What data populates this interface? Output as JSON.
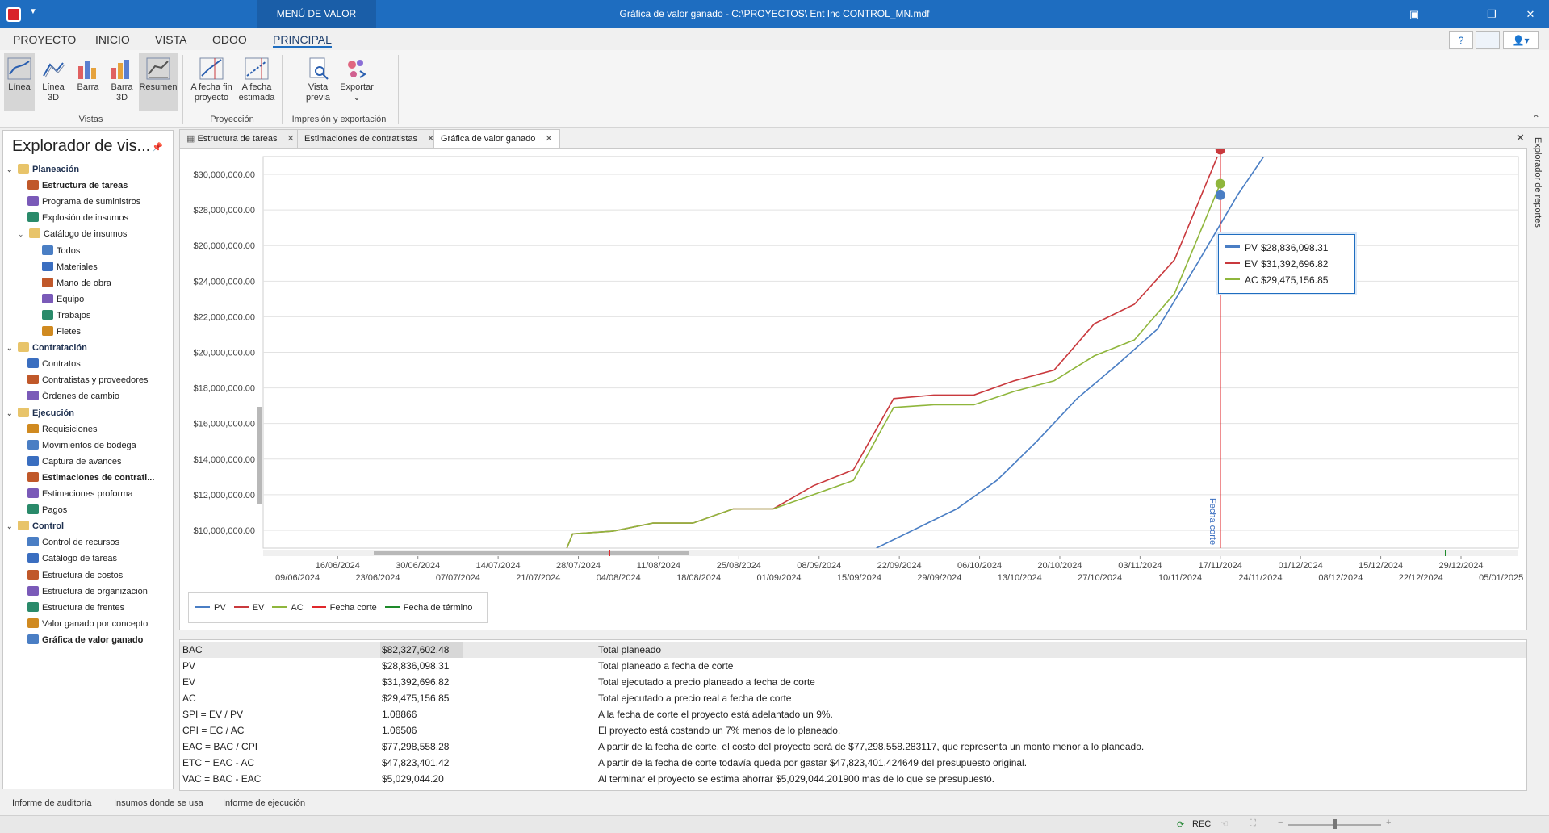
{
  "titlebar": {
    "menu_tab": "MENÚ DE VALOR GANADO",
    "title": "Gráfica de valor ganado - C:\\PROYECTOS\\ Ent Inc CONTROL_MN.mdf"
  },
  "ribbon_tabs": [
    "PROYECTO",
    "INICIO",
    "VISTA",
    "ODOO",
    "PRINCIPAL"
  ],
  "help_label": "?",
  "ribbon": {
    "views": [
      "Línea",
      "Línea 3D",
      "Barra",
      "Barra 3D",
      "Resumen"
    ],
    "projection": [
      "A fecha fin proyecto",
      "A fecha estimada"
    ],
    "print": [
      "Vista previa",
      "Exportar"
    ],
    "group_views": "Vistas",
    "group_projection": "Proyección",
    "group_print": "Impresión y exportación"
  },
  "explorer": {
    "title": "Explorador de vis...",
    "items": [
      {
        "label": "Planeación",
        "level": 0,
        "type": "head"
      },
      {
        "label": "Estructura de tareas",
        "level": 1,
        "bold": true
      },
      {
        "label": "Programa de suministros",
        "level": 1
      },
      {
        "label": "Explosión de insumos",
        "level": 1
      },
      {
        "label": "Catálogo de insumos",
        "level": 1,
        "type": "sub"
      },
      {
        "label": "Todos",
        "level": 2
      },
      {
        "label": "Materiales",
        "level": 2
      },
      {
        "label": "Mano de obra",
        "level": 2
      },
      {
        "label": "Equipo",
        "level": 2
      },
      {
        "label": "Trabajos",
        "level": 2
      },
      {
        "label": "Fletes",
        "level": 2
      },
      {
        "label": "Contratación",
        "level": 0,
        "type": "head"
      },
      {
        "label": "Contratos",
        "level": 1
      },
      {
        "label": "Contratistas y proveedores",
        "level": 1
      },
      {
        "label": "Órdenes de cambio",
        "level": 1
      },
      {
        "label": "Ejecución",
        "level": 0,
        "type": "head"
      },
      {
        "label": "Requisiciones",
        "level": 1
      },
      {
        "label": "Movimientos de bodega",
        "level": 1
      },
      {
        "label": "Captura de avances",
        "level": 1
      },
      {
        "label": "Estimaciones de contrati...",
        "level": 1,
        "bold": true
      },
      {
        "label": "Estimaciones proforma",
        "level": 1
      },
      {
        "label": "Pagos",
        "level": 1
      },
      {
        "label": "Control",
        "level": 0,
        "type": "head"
      },
      {
        "label": "Control de recursos",
        "level": 1
      },
      {
        "label": "Catálogo de tareas",
        "level": 1
      },
      {
        "label": "Estructura de costos",
        "level": 1
      },
      {
        "label": "Estructura de organización",
        "level": 1
      },
      {
        "label": "Estructura de frentes",
        "level": 1
      },
      {
        "label": "Valor ganado por concepto",
        "level": 1
      },
      {
        "label": "Gráfica de valor ganado",
        "level": 1,
        "bold": true
      }
    ]
  },
  "doc_tabs": [
    "Estructura de tareas",
    "Estimaciones de contratistas",
    "Gráfica de valor ganado"
  ],
  "chart_data": {
    "type": "line",
    "y_ticks": [
      "$10,000,000.00",
      "$12,000,000.00",
      "$14,000,000.00",
      "$16,000,000.00",
      "$18,000,000.00",
      "$20,000,000.00",
      "$22,000,000.00",
      "$24,000,000.00",
      "$26,000,000.00",
      "$28,000,000.00",
      "$30,000,000.00"
    ],
    "ylim": [
      9000000,
      31000000
    ],
    "x_ticks_top": [
      "16/06/2024",
      "30/06/2024",
      "14/07/2024",
      "28/07/2024",
      "11/08/2024",
      "25/08/2024",
      "08/09/2024",
      "22/09/2024",
      "06/10/2024",
      "20/10/2024",
      "03/11/2024",
      "17/11/2024",
      "01/12/2024",
      "15/12/2024",
      "29/12/2024"
    ],
    "x_ticks_bottom": [
      "09/06/2024",
      "23/06/2024",
      "07/07/2024",
      "21/07/2024",
      "04/08/2024",
      "18/08/2024",
      "01/09/2024",
      "15/09/2024",
      "29/09/2024",
      "13/10/2024",
      "27/10/2024",
      "10/11/2024",
      "24/11/2024",
      "08/12/2024",
      "22/12/2024",
      "05/01/2025"
    ],
    "series": [
      {
        "name": "PV",
        "color": "#4a7ec4",
        "points": [
          [
            "2024-09-18",
            9000000
          ],
          [
            "2024-10-02",
            11200000
          ],
          [
            "2024-10-09",
            12800000
          ],
          [
            "2024-10-16",
            15000000
          ],
          [
            "2024-10-23",
            17400000
          ],
          [
            "2024-10-30",
            19300000
          ],
          [
            "2024-11-06",
            21300000
          ],
          [
            "2024-11-13",
            25000000
          ],
          [
            "2024-11-20",
            28836098.31
          ],
          [
            "2024-11-25",
            31200000
          ]
        ]
      },
      {
        "name": "EV",
        "color": "#c9393d",
        "points": [
          [
            "2024-07-26",
            9000000
          ],
          [
            "2024-07-27",
            9800000
          ],
          [
            "2024-08-03",
            9950000
          ],
          [
            "2024-08-10",
            10400000
          ],
          [
            "2024-08-17",
            10400000
          ],
          [
            "2024-08-24",
            11200000
          ],
          [
            "2024-08-31",
            11200000
          ],
          [
            "2024-09-07",
            12500000
          ],
          [
            "2024-09-14",
            13400000
          ],
          [
            "2024-09-21",
            17400000
          ],
          [
            "2024-09-28",
            17600000
          ],
          [
            "2024-10-05",
            17600000
          ],
          [
            "2024-10-12",
            18400000
          ],
          [
            "2024-10-19",
            19000000
          ],
          [
            "2024-10-26",
            21600000
          ],
          [
            "2024-11-02",
            22700000
          ],
          [
            "2024-11-09",
            25200000
          ],
          [
            "2024-11-17",
            31392696.82
          ]
        ]
      },
      {
        "name": "AC",
        "color": "#8fb63c",
        "points": [
          [
            "2024-07-26",
            9000000
          ],
          [
            "2024-07-27",
            9800000
          ],
          [
            "2024-08-03",
            9950000
          ],
          [
            "2024-08-10",
            10400000
          ],
          [
            "2024-08-17",
            10400000
          ],
          [
            "2024-08-24",
            11200000
          ],
          [
            "2024-08-31",
            11200000
          ],
          [
            "2024-09-07",
            12000000
          ],
          [
            "2024-09-14",
            12800000
          ],
          [
            "2024-09-21",
            16900000
          ],
          [
            "2024-09-28",
            17050000
          ],
          [
            "2024-10-05",
            17050000
          ],
          [
            "2024-10-12",
            17800000
          ],
          [
            "2024-10-19",
            18400000
          ],
          [
            "2024-10-26",
            19800000
          ],
          [
            "2024-11-02",
            20700000
          ],
          [
            "2024-11-09",
            23300000
          ],
          [
            "2024-11-17",
            29475156.85
          ]
        ]
      }
    ],
    "cut_line_label": "Fecha corte",
    "legend": [
      {
        "name": "PV",
        "color": "#4a7ec4"
      },
      {
        "name": "EV",
        "color": "#c9393d"
      },
      {
        "name": "AC",
        "color": "#8fb63c"
      },
      {
        "name": "Fecha corte",
        "color": "#e0282b"
      },
      {
        "name": "Fecha de término",
        "color": "#1e8a2a"
      }
    ],
    "tooltip": [
      {
        "name": "PV",
        "value": "$28,836,098.31",
        "color": "#4a7ec4"
      },
      {
        "name": "EV",
        "value": "$31,392,696.82",
        "color": "#c9393d"
      },
      {
        "name": "AC",
        "value": "$29,475,156.85",
        "color": "#8fb63c"
      }
    ]
  },
  "metrics": [
    {
      "k": "BAC",
      "v": "$82,327,602.48",
      "d": "Total planeado"
    },
    {
      "k": "PV",
      "v": "$28,836,098.31",
      "d": "Total planeado a fecha de corte"
    },
    {
      "k": "EV",
      "v": "$31,392,696.82",
      "d": "Total ejecutado a precio planeado a fecha de corte"
    },
    {
      "k": "AC",
      "v": "$29,475,156.85",
      "d": "Total ejecutado a precio real a fecha de corte"
    },
    {
      "k": "SPI = EV / PV",
      "v": "1.08866",
      "d": "A la fecha de corte el proyecto está adelantado un 9%."
    },
    {
      "k": "CPI = EC / AC",
      "v": "1.06506",
      "d": "El proyecto está costando un 7% menos de lo planeado."
    },
    {
      "k": "EAC = BAC / CPI",
      "v": "$77,298,558.28",
      "d": "A partir de la fecha de corte, el costo del proyecto será de $77,298,558.283117, que representa un monto menor a lo planeado."
    },
    {
      "k": "ETC = EAC - AC",
      "v": "$47,823,401.42",
      "d": "A partir de la fecha de corte todavía queda por gastar $47,823,401.424649 del presupuesto original."
    },
    {
      "k": "VAC = BAC - EAC",
      "v": "$5,029,044.20",
      "d": "Al terminar el proyecto se estima ahorrar $5,029,044.201900 mas de lo que se presupuestó."
    }
  ],
  "bottom_tabs": [
    "Informe de auditoría",
    "Insumos donde se usa",
    "Informe de ejecución"
  ],
  "status": {
    "rec": "REC"
  },
  "right_strip": "Explorador de reportes"
}
